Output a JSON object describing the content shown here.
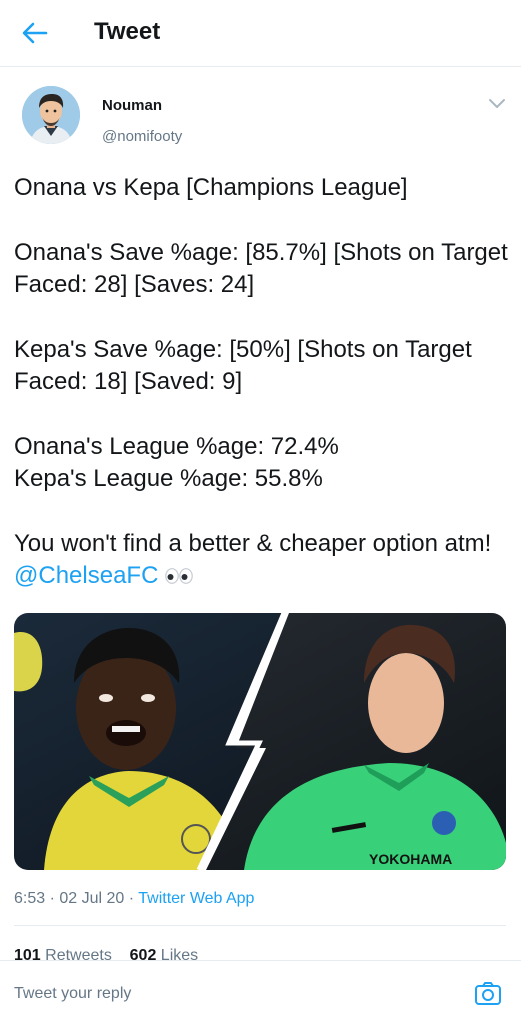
{
  "header": {
    "title": "Tweet",
    "back_icon": "arrow-left-icon"
  },
  "author": {
    "name": "Nouman",
    "handle": "@nomifooty"
  },
  "tweet": {
    "line1": "Onana vs Kepa [Champions League]",
    "line2": "Onana's Save %age: [85.7%] [Shots on Target Faced: 28] [Saves: 24]",
    "line3": "Kepa's Save %age: [50%] [Shots on Target Faced: 18] [Saved: 9]",
    "line4a": "Onana's League %age: 72.4%",
    "line4b": "Kepa's League %age: 55.8%",
    "line5_text": "You won't find a better & cheaper option atm! ",
    "line5_mention": "@ChelseaFC",
    "line5_emoji": "eyes-emoji"
  },
  "media": {
    "left_kit_text": "",
    "right_sponsor": "YOKOHAMA"
  },
  "meta": {
    "time": "6:53",
    "date": "02 Jul 20",
    "dot": "·",
    "app": "Twitter Web App"
  },
  "stats": {
    "retweets_count": "101",
    "retweets_label": "Retweets",
    "likes_count": "602",
    "likes_label": "Likes"
  },
  "reply": {
    "placeholder": "Tweet your reply"
  },
  "colors": {
    "accent": "#1da1f2",
    "muted": "#657786",
    "text": "#14171a",
    "divider": "#e6ecf0"
  }
}
